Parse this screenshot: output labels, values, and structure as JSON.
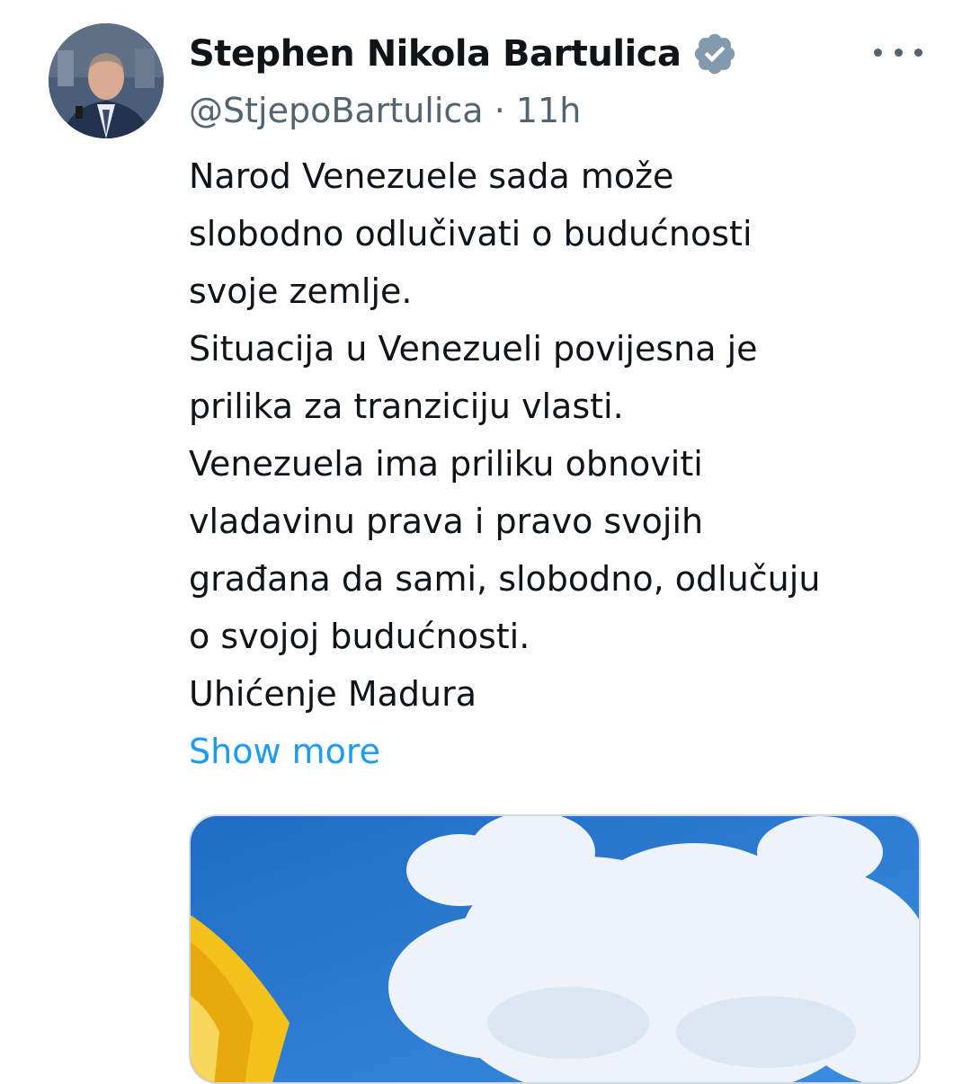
{
  "author": {
    "display_name": "Stephen Nikola Bartulica",
    "handle": "@StjepoBartulica",
    "separator": "·",
    "time": "11h",
    "verified_icon": "verified-badge-icon"
  },
  "post": {
    "lines": [
      "Narod Venezuele sada može",
      "slobodno odlučivati o budućnosti",
      "svoje zemlje.",
      "Situacija u Venezueli povijesna je",
      "prilika za tranziciju vlasti.",
      "Venezuela ima priliku obnoviti",
      "vladavinu prava i pravo svojih",
      "građana da sami, slobodno, odlučuju",
      "o svojoj budućnosti.",
      "Uhićenje Madura"
    ],
    "show_more_label": "Show more"
  },
  "colors": {
    "text": "#0f1419",
    "secondary": "#536471",
    "link": "#1d9bf0",
    "verified": "#829aab"
  },
  "icons": {
    "more": "more-dots-icon",
    "verified": "verified-badge-icon"
  }
}
